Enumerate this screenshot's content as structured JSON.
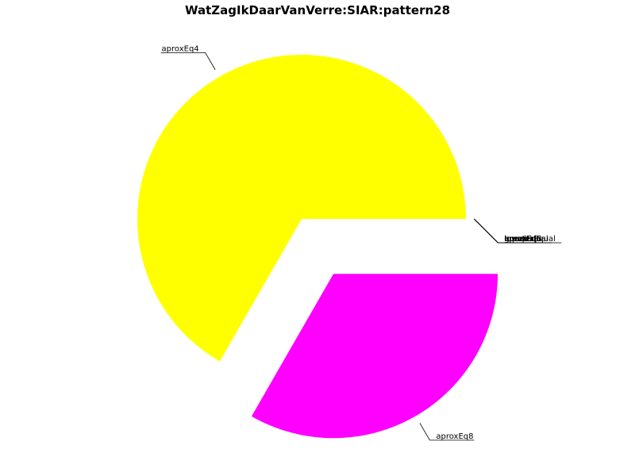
{
  "chart_data": {
    "type": "pie",
    "title": "WatZagIkDaarVanVerre:SIAR:pattern28",
    "start_angle_deg": 0,
    "direction": "counterclockwise",
    "slices": [
      {
        "label": "aproxEq4",
        "value": 0.667,
        "color": "#ffff00",
        "exploded": false
      },
      {
        "label": "aproxEq8",
        "value": 0.333,
        "color": "#ff00ff",
        "exploded": true
      },
      {
        "label": "aproxEq5",
        "value": 0,
        "color": "",
        "exploded": false
      },
      {
        "label": "aproxEq6",
        "value": 0,
        "color": "",
        "exploded": false
      },
      {
        "label": "lowerEqual",
        "value": 0,
        "color": "",
        "exploded": false
      },
      {
        "label": "greaterEqual",
        "value": 0,
        "color": "",
        "exploded": false
      },
      {
        "label": "equal",
        "value": 0,
        "color": "",
        "exploded": false
      },
      {
        "label": "unequal",
        "value": 0,
        "color": "",
        "exploded": false
      },
      {
        "label": "lower",
        "value": 0,
        "color": "",
        "exploded": false
      },
      {
        "label": "greater",
        "value": 0,
        "color": "",
        "exploded": false
      }
    ]
  }
}
